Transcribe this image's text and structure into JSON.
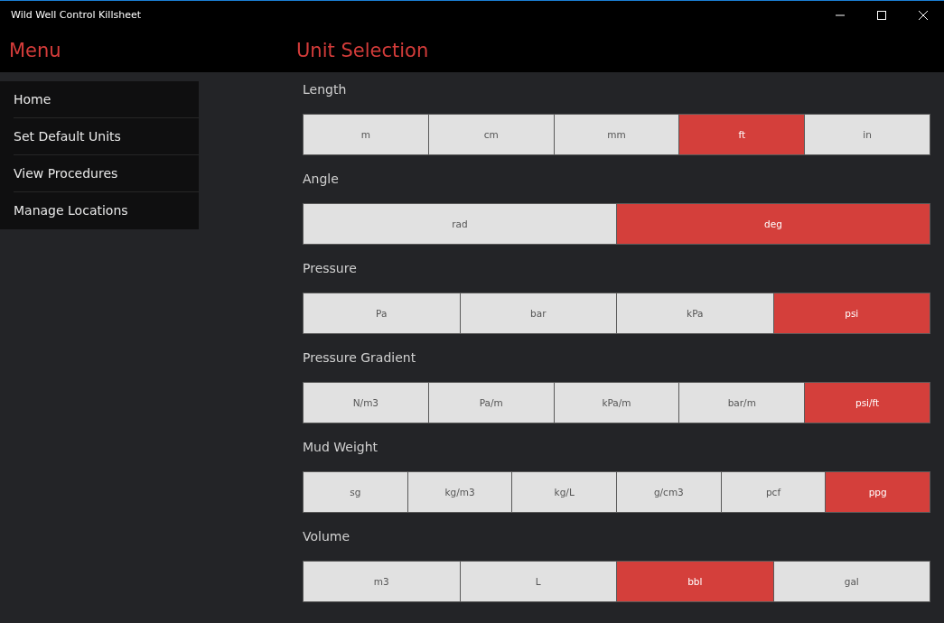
{
  "window": {
    "title": "Wild Well Control Killsheet"
  },
  "menu": {
    "title": "Menu",
    "items": [
      {
        "label": "Home"
      },
      {
        "label": "Set Default Units"
      },
      {
        "label": "View Procedures"
      },
      {
        "label": "Manage Locations"
      }
    ]
  },
  "page": {
    "title": "Unit Selection"
  },
  "groups": [
    {
      "label": "Length",
      "options": [
        {
          "label": "m",
          "selected": false
        },
        {
          "label": "cm",
          "selected": false
        },
        {
          "label": "mm",
          "selected": false
        },
        {
          "label": "ft",
          "selected": true
        },
        {
          "label": "in",
          "selected": false
        }
      ]
    },
    {
      "label": "Angle",
      "options": [
        {
          "label": "rad",
          "selected": false
        },
        {
          "label": "deg",
          "selected": true
        }
      ]
    },
    {
      "label": "Pressure",
      "options": [
        {
          "label": "Pa",
          "selected": false
        },
        {
          "label": "bar",
          "selected": false
        },
        {
          "label": "kPa",
          "selected": false
        },
        {
          "label": "psi",
          "selected": true
        }
      ]
    },
    {
      "label": "Pressure Gradient",
      "options": [
        {
          "label": "N/m3",
          "selected": false
        },
        {
          "label": "Pa/m",
          "selected": false
        },
        {
          "label": "kPa/m",
          "selected": false
        },
        {
          "label": "bar/m",
          "selected": false
        },
        {
          "label": "psi/ft",
          "selected": true
        }
      ]
    },
    {
      "label": "Mud Weight",
      "options": [
        {
          "label": "sg",
          "selected": false
        },
        {
          "label": "kg/m3",
          "selected": false
        },
        {
          "label": "kg/L",
          "selected": false
        },
        {
          "label": "g/cm3",
          "selected": false
        },
        {
          "label": "pcf",
          "selected": false
        },
        {
          "label": "ppg",
          "selected": true
        }
      ]
    },
    {
      "label": "Volume",
      "options": [
        {
          "label": "m3",
          "selected": false
        },
        {
          "label": "L",
          "selected": false
        },
        {
          "label": "bbl",
          "selected": true
        },
        {
          "label": "gal",
          "selected": false
        }
      ]
    }
  ]
}
